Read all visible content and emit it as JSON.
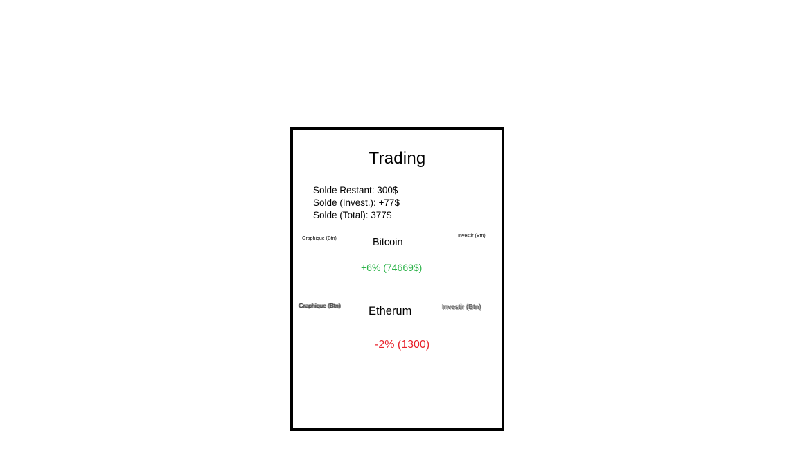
{
  "app": {
    "title": "Trading"
  },
  "balances": {
    "remaining": "Solde Restant: 300$",
    "invested": "Solde (Invest.): +77$",
    "total": "Solde (Total): 377$"
  },
  "coins": [
    {
      "name": "Bitcoin",
      "change": "+6% (74669$)",
      "change_color": "#2db34a",
      "graph_button_label": "Graphique (Btn)",
      "invest_button_label": "Investir (Btn)"
    },
    {
      "name": "Etherum",
      "change": "-2% (1300)",
      "change_color": "#e8212b",
      "graph_button_label": "Graphique (Btn)",
      "invest_button_label": "Investir (Btn)"
    }
  ]
}
